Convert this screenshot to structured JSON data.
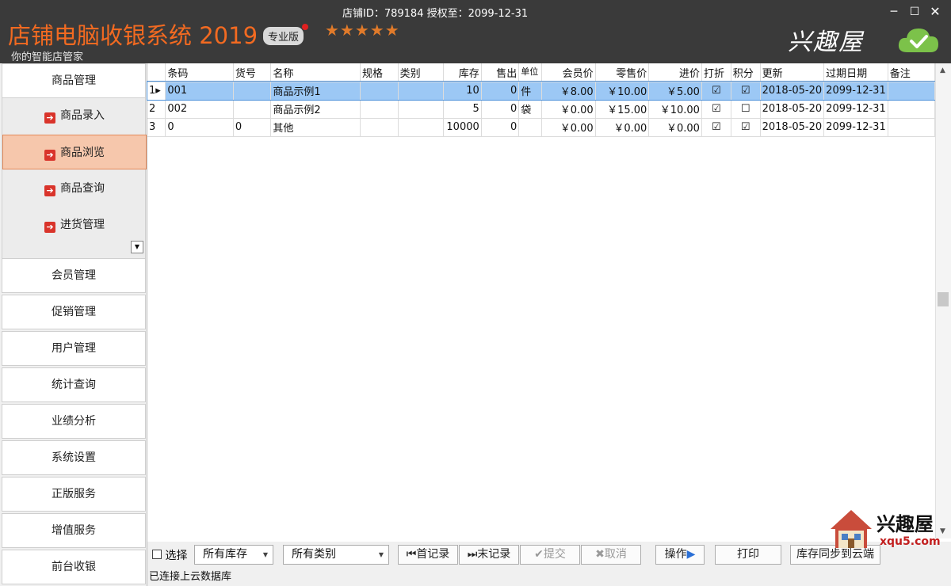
{
  "header": {
    "app_title": "店铺电脑收银系统 2019",
    "edition_badge": "专业版",
    "stars": "★★★★★",
    "subtitle": "你的智能店管家",
    "store_info": "店铺ID：789184 授权至：2099-12-31",
    "brand": "兴趣屋"
  },
  "window_controls": {
    "minimize": "─",
    "maximize": "☐",
    "close": "✕"
  },
  "sidebar": {
    "main_items": [
      "商品管理",
      "会员管理",
      "促销管理",
      "用户管理",
      "统计查询",
      "业绩分析",
      "系统设置",
      "正版服务",
      "增值服务",
      "前台收银"
    ],
    "sub_items": [
      "商品录入",
      "商品浏览",
      "商品查询",
      "进货管理"
    ],
    "active_sub": "商品浏览"
  },
  "grid": {
    "columns": [
      "条码",
      "货号",
      "名称",
      "规格",
      "类别",
      "库存",
      "售出",
      "单位",
      "会员价",
      "零售价",
      "进价",
      "打折",
      "积分",
      "更新",
      "过期日期",
      "备注"
    ],
    "rows": [
      {
        "index": "1",
        "barcode": "001",
        "item_no": "",
        "name": "商品示例1",
        "spec": "",
        "category": "",
        "stock": "10",
        "sold": "0",
        "unit": "件",
        "member_price": "￥8.00",
        "retail_price": "￥10.00",
        "cost": "￥5.00",
        "discount": "☑",
        "points": "☑",
        "updated": "2018-05-20",
        "expiry": "2099-12-31",
        "note": ""
      },
      {
        "index": "2",
        "barcode": "002",
        "item_no": "",
        "name": "商品示例2",
        "spec": "",
        "category": "",
        "stock": "5",
        "sold": "0",
        "unit": "袋",
        "member_price": "￥0.00",
        "retail_price": "￥15.00",
        "cost": "￥10.00",
        "discount": "☑",
        "points": "☐",
        "updated": "2018-05-20",
        "expiry": "2099-12-31",
        "note": ""
      },
      {
        "index": "3",
        "barcode": "0",
        "item_no": "0",
        "name": "其他",
        "spec": "",
        "category": "",
        "stock": "10000",
        "sold": "0",
        "unit": "",
        "member_price": "￥0.00",
        "retail_price": "￥0.00",
        "cost": "￥0.00",
        "discount": "☑",
        "points": "☑",
        "updated": "2018-05-20",
        "expiry": "2099-12-31",
        "note": ""
      }
    ],
    "selected_row": 1
  },
  "toolbar": {
    "select_label": "选择",
    "stock_filter": "所有库存",
    "category_filter": "所有类别",
    "first_record": "首记录",
    "last_record": "末记录",
    "submit": "提交",
    "cancel": "取消",
    "operate": "操作",
    "print": "打印",
    "sync": "库存同步到云端"
  },
  "status": {
    "text": "已连接上云数据库"
  },
  "watermark": {
    "text": "兴趣屋",
    "url": "xqu5.com"
  },
  "colors": {
    "accent": "#f26a21",
    "titlebar": "#3a3a3a",
    "selected_row": "#9cc8f5",
    "active_nav": "#f6c7ac"
  }
}
